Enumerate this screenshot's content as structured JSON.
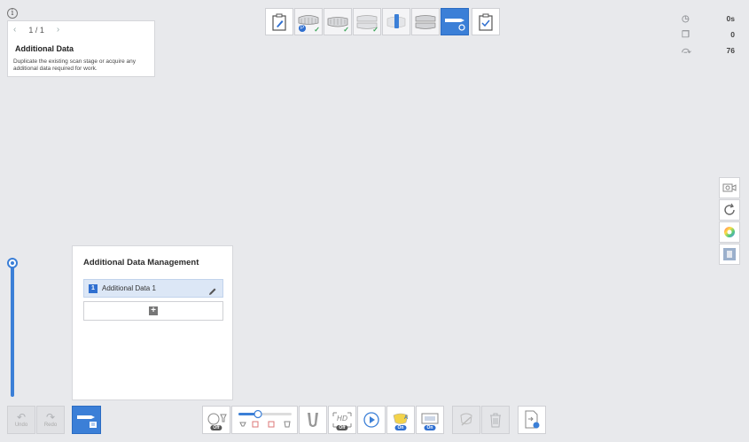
{
  "guide": {
    "page_indicator": "1 / 1",
    "title": "Additional Data",
    "description": "Duplicate the existing scan stage or acquire any additional data required for work."
  },
  "stages": [
    {
      "name": "case-form",
      "completed": false,
      "active": false
    },
    {
      "name": "upper-jaw",
      "completed": true,
      "active": false
    },
    {
      "name": "lower-jaw",
      "completed": true,
      "active": false
    },
    {
      "name": "occlusion",
      "completed": true,
      "active": false
    },
    {
      "name": "abutment",
      "completed": false,
      "active": false
    },
    {
      "name": "pre-op",
      "completed": false,
      "active": false
    },
    {
      "name": "additional-data",
      "completed": false,
      "active": true
    },
    {
      "name": "review",
      "completed": false,
      "active": false
    }
  ],
  "stats": {
    "time": "0s",
    "copies": "0",
    "frames": "76"
  },
  "additional_data_management": {
    "title": "Additional Data Management",
    "items": [
      {
        "number": "1",
        "label": "Additional Data 1"
      }
    ]
  },
  "undo_label": "Undo",
  "redo_label": "Redo",
  "bottom_toggles": {
    "smart_filter": "Off",
    "hd": "Off",
    "ai_a": "On",
    "ai_b": "On"
  },
  "slider": {
    "level": 0.25
  },
  "colors": {
    "accent": "#3b7fd7",
    "check": "#3aa357",
    "background": "#e8e9ec"
  }
}
